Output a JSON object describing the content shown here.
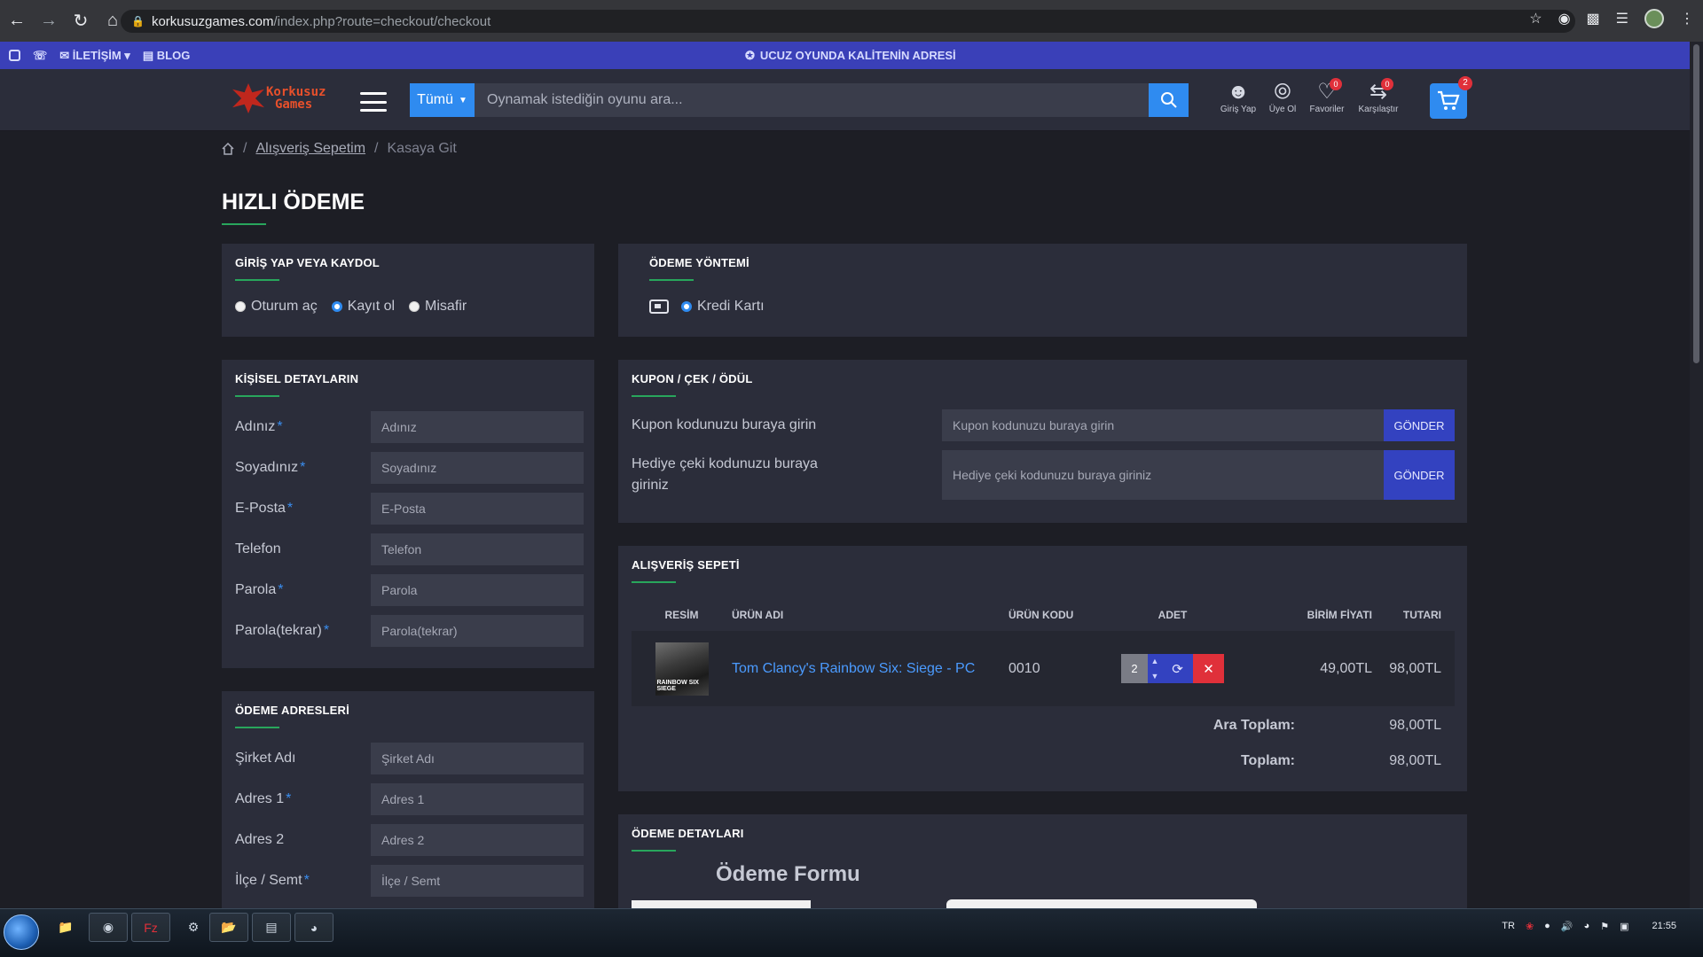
{
  "browser": {
    "url_host": "korkusuzgames.com",
    "url_path": "/index.php?route=checkout/checkout"
  },
  "topstrip": {
    "contact": "İLETİŞİM",
    "blog": "BLOG",
    "slogan": "UCUZ OYUNDA KALİTENİN ADRESİ"
  },
  "header": {
    "logo_line1": "Korkusuz",
    "logo_line2": "Games",
    "category": "Tümü",
    "search_placeholder": "Oynamak istediğin oyunu ara...",
    "icons": [
      {
        "label": "Giriş Yap"
      },
      {
        "label": "Üye Ol"
      },
      {
        "label": "Favoriler",
        "badge": "0"
      },
      {
        "label": "Karşılaştır",
        "badge": "0"
      }
    ],
    "cart_count": "2"
  },
  "breadcrumb": {
    "cart": "Alışveriş Sepetim",
    "current": "Kasaya Git"
  },
  "page_title": "HIZLI ÖDEME",
  "login_panel": {
    "title": "GİRİŞ YAP VEYA KAYDOL",
    "options": [
      "Oturum aç",
      "Kayıt ol",
      "Misafir"
    ],
    "selected_index": 1
  },
  "payment_method": {
    "title": "ÖDEME YÖNTEMİ",
    "option": "Kredi Kartı"
  },
  "personal": {
    "title": "KİŞİSEL DETAYLARIN",
    "fields": [
      {
        "label": "Adınız",
        "placeholder": "Adınız",
        "required": "*"
      },
      {
        "label": "Soyadınız",
        "placeholder": "Soyadınız",
        "required": "*"
      },
      {
        "label": "E-Posta",
        "placeholder": "E-Posta",
        "required": "*"
      },
      {
        "label": "Telefon",
        "placeholder": "Telefon",
        "required": ""
      },
      {
        "label": "Parola",
        "placeholder": "Parola",
        "required": "*"
      },
      {
        "label": "Parola(tekrar)",
        "placeholder": "Parola(tekrar)",
        "required": "*"
      }
    ]
  },
  "coupon": {
    "title": "KUPON / ÇEK / ÖDÜL",
    "coupon_label": "Kupon kodunuzu buraya girin",
    "coupon_placeholder": "Kupon kodunuzu buraya girin",
    "gift_label": "Hediye çeki kodunuzu buraya giriniz",
    "gift_placeholder": "Hediye çeki kodunuzu buraya giriniz",
    "send": "GÖNDER"
  },
  "cart": {
    "title": "ALIŞVERİŞ SEPETİ",
    "headers": {
      "image": "RESİM",
      "name": "ÜRÜN ADI",
      "code": "ÜRÜN KODU",
      "qty": "ADET",
      "unit": "BİRİM FİYATI",
      "total": "TUTARI"
    },
    "item": {
      "thumb_text": "RAINBOW SIX SIEGE",
      "name": "Tom Clancy's Rainbow Six: Siege - PC",
      "code": "0010",
      "qty": "2",
      "unit_price": "49,00TL",
      "total": "98,00TL"
    },
    "subtotal_label": "Ara Toplam:",
    "subtotal": "98,00TL",
    "total_label": "Toplam:",
    "total": "98,00TL"
  },
  "address": {
    "title": "ÖDEME ADRESLERİ",
    "fields": [
      {
        "label": "Şirket Adı",
        "placeholder": "Şirket Adı",
        "required": ""
      },
      {
        "label": "Adres 1",
        "placeholder": "Adres 1",
        "required": "*"
      },
      {
        "label": "Adres 2",
        "placeholder": "Adres 2",
        "required": ""
      },
      {
        "label": "İlçe / Semt",
        "placeholder": "İlçe / Semt",
        "required": "*"
      }
    ]
  },
  "payment_details": {
    "title": "ÖDEME DETAYLARI",
    "form_heading": "Ödeme Formu"
  },
  "taskbar": {
    "lang": "TR",
    "time": "21:55"
  }
}
